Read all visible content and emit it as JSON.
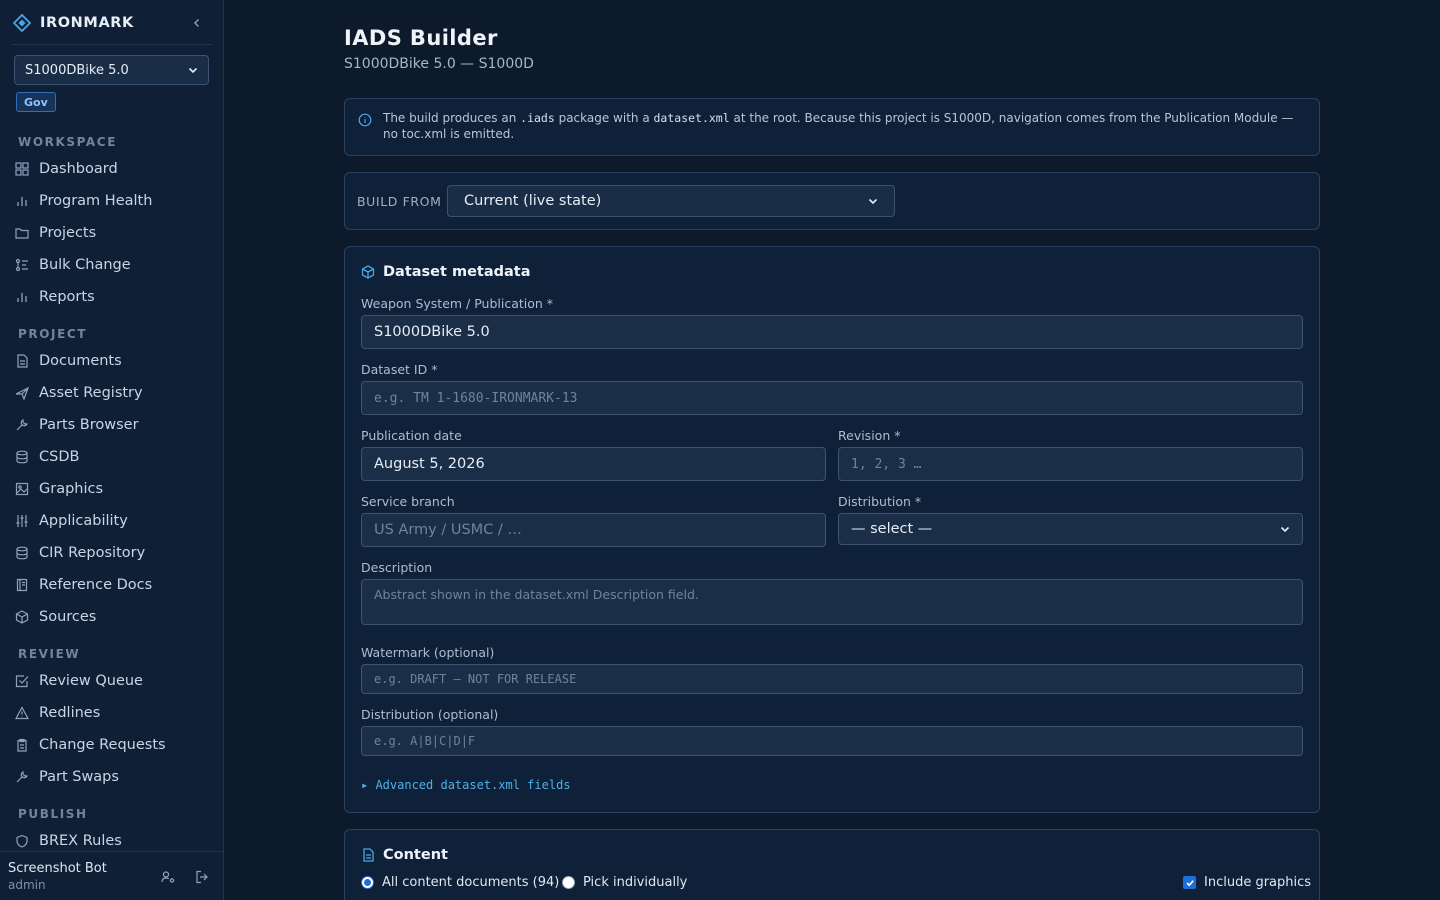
{
  "sidebar": {
    "brand": "IRONMARK",
    "project_select": "S1000DBike 5.0",
    "badge": "Gov",
    "sections": {
      "workspace": "WORKSPACE",
      "project": "PROJECT",
      "review": "REVIEW",
      "publish": "PUBLISH"
    },
    "workspace_items": [
      "Dashboard",
      "Program Health",
      "Projects",
      "Bulk Change",
      "Reports"
    ],
    "project_items": [
      "Documents",
      "Asset Registry",
      "Parts Browser",
      "CSDB",
      "Graphics",
      "Applicability",
      "CIR Repository",
      "Reference Docs",
      "Sources"
    ],
    "review_items": [
      "Review Queue",
      "Redlines",
      "Change Requests",
      "Part Swaps"
    ],
    "publish_items": [
      "BREX Rules"
    ],
    "user": {
      "name": "Screenshot Bot",
      "role": "admin"
    }
  },
  "header": {
    "title": "IADS Builder",
    "subtitle": "S1000DBike 5.0 — S1000D"
  },
  "info": {
    "t1": "The build produces an ",
    "c1": ".iads",
    "t2": " package with a ",
    "c2": "dataset.xml",
    "t3": " at the root. Because this project is S1000D, navigation comes from the Publication Module — no toc.xml is emitted."
  },
  "build": {
    "label": "BUILD FROM",
    "value": "Current (live state)"
  },
  "metadata": {
    "title": "Dataset metadata",
    "weapon_label": "Weapon System / Publication *",
    "weapon_value": "S1000DBike 5.0",
    "dataset_id_label": "Dataset ID *",
    "dataset_id_placeholder": "e.g. TM 1-1680-IRONMARK-13",
    "pub_date_label": "Publication date",
    "pub_date_value": "August 5, 2026",
    "revision_label": "Revision *",
    "revision_placeholder": "1, 2, 3 …",
    "service_label": "Service branch",
    "service_placeholder": "US Army / USMC / …",
    "distribution_label": "Distribution *",
    "distribution_value": "— select —",
    "description_label": "Description",
    "description_placeholder": "Abstract shown in the dataset.xml Description field.",
    "watermark_label": "Watermark (optional)",
    "watermark_placeholder": "e.g. DRAFT — NOT FOR RELEASE",
    "distribution_opt_label": "Distribution (optional)",
    "distribution_opt_placeholder": "e.g. A|B|C|D|F",
    "advanced": "▸ Advanced dataset.xml fields"
  },
  "content": {
    "title": "Content",
    "radio_all": "All content documents (94)",
    "radio_pick": "Pick individually",
    "include_graphics": "Include graphics"
  },
  "colors": {
    "background": "#0c1a2b",
    "sidebar": "#0f2036",
    "accent": "#4aa6e6",
    "badge": "#8fc2ff"
  }
}
